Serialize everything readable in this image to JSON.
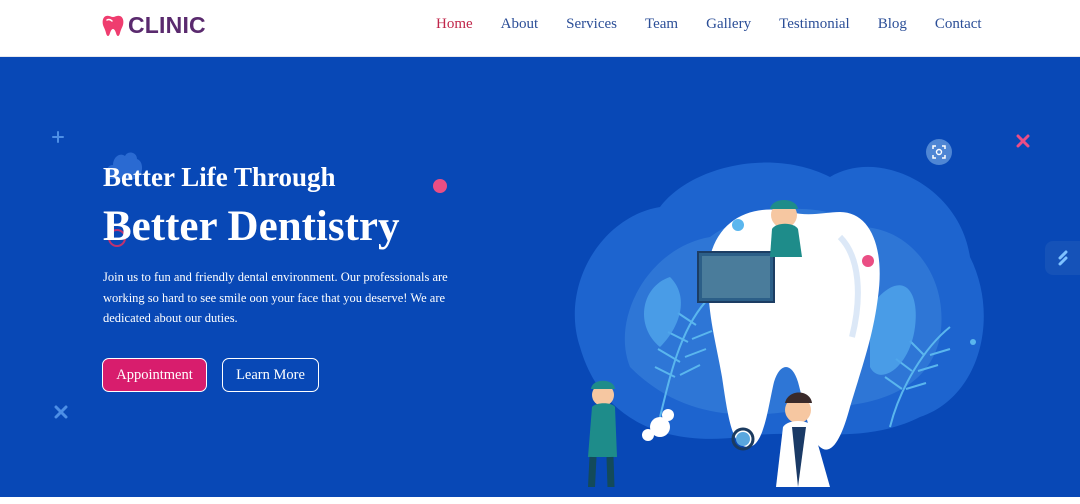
{
  "brand": {
    "name": "CLINIC",
    "logo_icon": "tooth-icon",
    "logo_color": "#ef3d6f",
    "text_color": "#5a2a6e"
  },
  "nav": {
    "items": [
      {
        "label": "Home",
        "active": true
      },
      {
        "label": "About",
        "active": false
      },
      {
        "label": "Services",
        "active": false
      },
      {
        "label": "Team",
        "active": false
      },
      {
        "label": "Gallery",
        "active": false
      },
      {
        "label": "Testimonial",
        "active": false
      },
      {
        "label": "Blog",
        "active": false
      },
      {
        "label": "Contact",
        "active": false
      }
    ],
    "link_color": "#2b4e97",
    "active_color": "#c0264a"
  },
  "hero": {
    "title_small": "Better Life Through",
    "title_big": "Better Dentistry",
    "description": "Join us to fun and friendly dental environment. Our professionals are working so hard to see smile oon your face that you deserve! We are dedicated about our duties.",
    "primary_button": "Appointment",
    "secondary_button": "Learn More",
    "background_color": "#0848b6",
    "accent_color": "#d81d6d"
  },
  "icons": {
    "illustration": "dentists-with-giant-tooth-illustration",
    "zoom": "scan-zoom-icon",
    "side_widget": "lightning-icon"
  }
}
